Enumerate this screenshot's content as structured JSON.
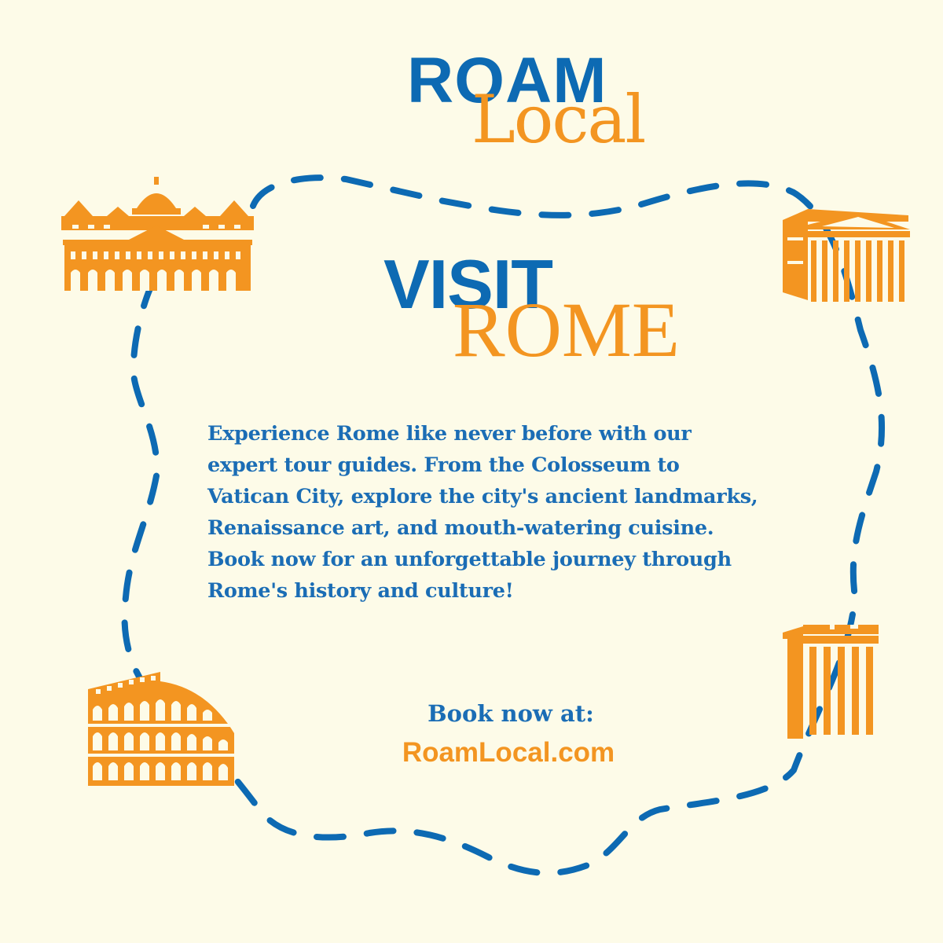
{
  "colors": {
    "background": "#fdfbe8",
    "blue": "#0d6ab3",
    "text_blue": "#1b6db5",
    "orange": "#f39521"
  },
  "logo": {
    "roam": "ROAM",
    "local": "Local"
  },
  "headline": {
    "visit": "VISIT",
    "rome": "ROME"
  },
  "body": {
    "lines": [
      "Experience Rome like never before with our",
      "expert tour guides. From the Colosseum to",
      "Vatican City, explore the city's ancient landmarks,",
      "Renaissance art, and mouth-watering cuisine.",
      "Book now for an unforgettable journey through",
      "Rome's history and culture!"
    ]
  },
  "cta": {
    "label": "Book now at:",
    "url": "RoamLocal.com"
  },
  "icons": [
    "st-peters-basilica-icon",
    "pantheon-icon",
    "colosseum-icon",
    "temple-ruins-icon"
  ]
}
